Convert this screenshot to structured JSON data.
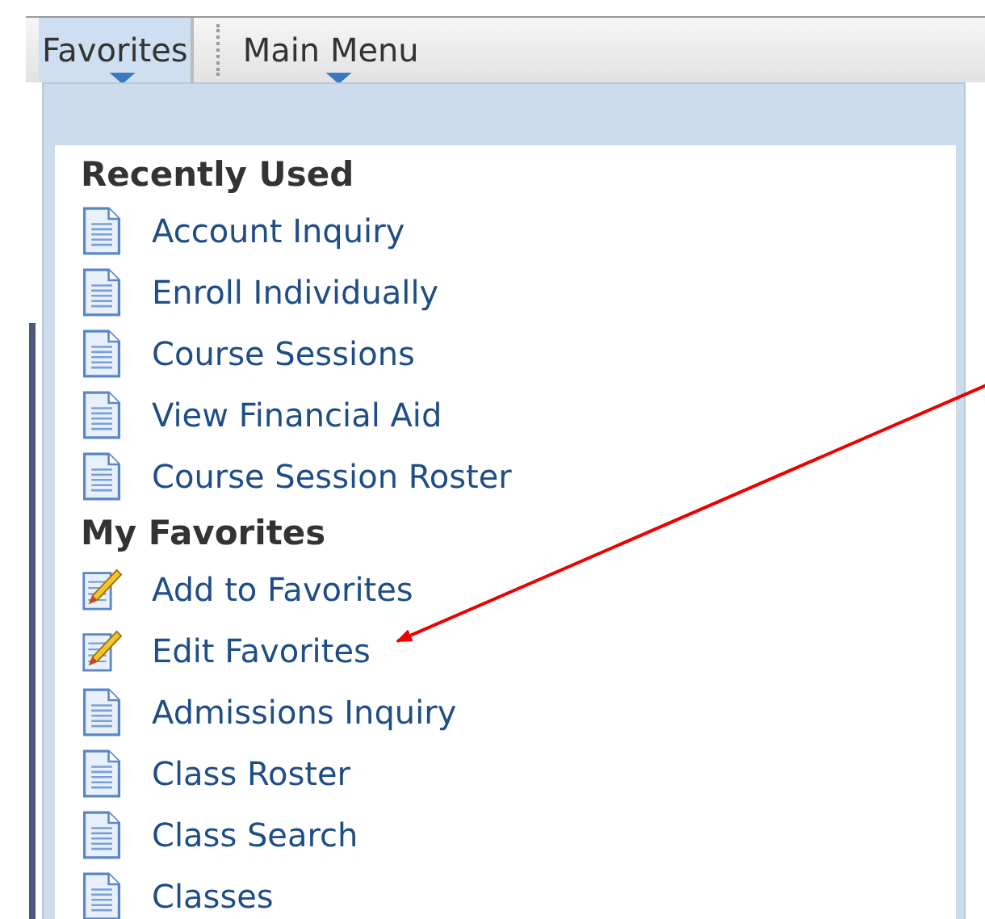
{
  "menu_bar": {
    "tabs": [
      {
        "label": "Favorites",
        "selected": true
      },
      {
        "label": "Main Menu",
        "selected": false
      }
    ]
  },
  "dropdown": {
    "sections": [
      {
        "heading": "Recently Used",
        "items": [
          {
            "label": "Account Inquiry",
            "kind": "page"
          },
          {
            "label": "Enroll Individually",
            "kind": "page"
          },
          {
            "label": "Course Sessions",
            "kind": "page"
          },
          {
            "label": "View Financial Aid",
            "kind": "page"
          },
          {
            "label": "Course Session Roster",
            "kind": "page"
          }
        ]
      },
      {
        "heading": "My Favorites",
        "items": [
          {
            "label": "Add to Favorites",
            "kind": "edit"
          },
          {
            "label": "Edit Favorites",
            "kind": "edit"
          },
          {
            "label": "Admissions Inquiry",
            "kind": "page"
          },
          {
            "label": "Class Roster",
            "kind": "page"
          },
          {
            "label": "Class Search",
            "kind": "page"
          },
          {
            "label": "Classes",
            "kind": "page"
          }
        ]
      }
    ]
  }
}
